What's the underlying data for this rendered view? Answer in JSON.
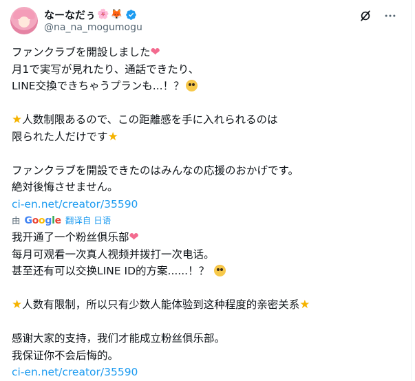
{
  "user": {
    "display_name": "なーなだぅ",
    "handle": "@na_na_mogumogu",
    "badge_emojis": [
      "🌸",
      "🦊"
    ]
  },
  "icons": [
    "grok-icon",
    "more-icon",
    "verified-badge-icon"
  ],
  "colors": {
    "link": "#1d9bf0",
    "muted": "#536471",
    "text": "#0f1419",
    "verified": "#1d9bf0"
  },
  "original": {
    "line1": "ファンクラブを開設しました",
    "line2": "月1で実写が見れたり、通話できたり、",
    "line3": "LINE交換できちゃうプランも...！？",
    "line4": "人数制限あるので、この距離感を手に入れられるのは",
    "line5": "限られた人だけです",
    "line6": "ファンクラブを開設できたのはみんなの応援のおかげです。",
    "line7": "絶対後悔させません。",
    "link": "ci-en.net/creator/35590"
  },
  "translation_bar": {
    "prefix": "由",
    "provider": "Google",
    "label": "翻译自 日语"
  },
  "translated": {
    "line1": "我开通了一个粉丝俱乐部",
    "line2": "每月可观看一次真人视频并拨打一次电话。",
    "line3": "甚至还有可以交换LINE ID的方案......！？",
    "line4": "人数有限制，所以只有少数人能体验到这种程度的亲密关系",
    "line5": "感谢大家的支持，我们才能成立粉丝俱乐部。",
    "line6": "我保证你不会后悔的。",
    "link": "ci-en.net/creator/35590"
  }
}
